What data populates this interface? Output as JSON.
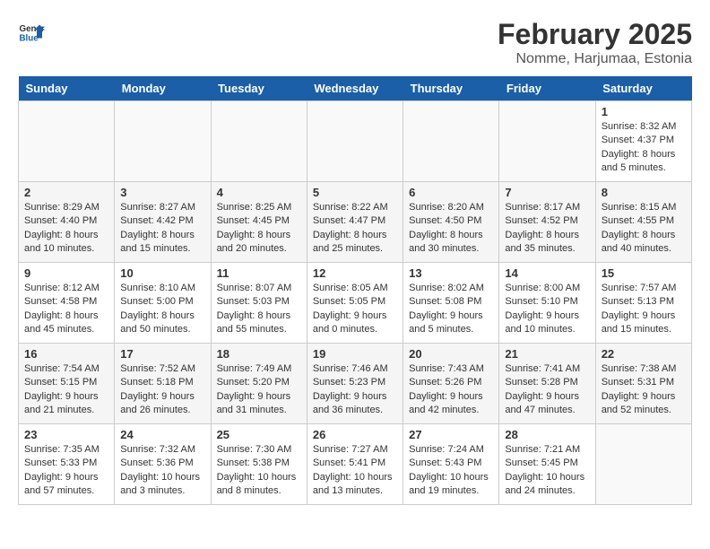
{
  "header": {
    "logo_line1": "General",
    "logo_line2": "Blue",
    "title": "February 2025",
    "subtitle": "Nomme, Harjumaa, Estonia"
  },
  "days_of_week": [
    "Sunday",
    "Monday",
    "Tuesday",
    "Wednesday",
    "Thursday",
    "Friday",
    "Saturday"
  ],
  "weeks": [
    [
      {
        "num": "",
        "info": ""
      },
      {
        "num": "",
        "info": ""
      },
      {
        "num": "",
        "info": ""
      },
      {
        "num": "",
        "info": ""
      },
      {
        "num": "",
        "info": ""
      },
      {
        "num": "",
        "info": ""
      },
      {
        "num": "1",
        "info": "Sunrise: 8:32 AM\nSunset: 4:37 PM\nDaylight: 8 hours and 5 minutes."
      }
    ],
    [
      {
        "num": "2",
        "info": "Sunrise: 8:29 AM\nSunset: 4:40 PM\nDaylight: 8 hours and 10 minutes."
      },
      {
        "num": "3",
        "info": "Sunrise: 8:27 AM\nSunset: 4:42 PM\nDaylight: 8 hours and 15 minutes."
      },
      {
        "num": "4",
        "info": "Sunrise: 8:25 AM\nSunset: 4:45 PM\nDaylight: 8 hours and 20 minutes."
      },
      {
        "num": "5",
        "info": "Sunrise: 8:22 AM\nSunset: 4:47 PM\nDaylight: 8 hours and 25 minutes."
      },
      {
        "num": "6",
        "info": "Sunrise: 8:20 AM\nSunset: 4:50 PM\nDaylight: 8 hours and 30 minutes."
      },
      {
        "num": "7",
        "info": "Sunrise: 8:17 AM\nSunset: 4:52 PM\nDaylight: 8 hours and 35 minutes."
      },
      {
        "num": "8",
        "info": "Sunrise: 8:15 AM\nSunset: 4:55 PM\nDaylight: 8 hours and 40 minutes."
      }
    ],
    [
      {
        "num": "9",
        "info": "Sunrise: 8:12 AM\nSunset: 4:58 PM\nDaylight: 8 hours and 45 minutes."
      },
      {
        "num": "10",
        "info": "Sunrise: 8:10 AM\nSunset: 5:00 PM\nDaylight: 8 hours and 50 minutes."
      },
      {
        "num": "11",
        "info": "Sunrise: 8:07 AM\nSunset: 5:03 PM\nDaylight: 8 hours and 55 minutes."
      },
      {
        "num": "12",
        "info": "Sunrise: 8:05 AM\nSunset: 5:05 PM\nDaylight: 9 hours and 0 minutes."
      },
      {
        "num": "13",
        "info": "Sunrise: 8:02 AM\nSunset: 5:08 PM\nDaylight: 9 hours and 5 minutes."
      },
      {
        "num": "14",
        "info": "Sunrise: 8:00 AM\nSunset: 5:10 PM\nDaylight: 9 hours and 10 minutes."
      },
      {
        "num": "15",
        "info": "Sunrise: 7:57 AM\nSunset: 5:13 PM\nDaylight: 9 hours and 15 minutes."
      }
    ],
    [
      {
        "num": "16",
        "info": "Sunrise: 7:54 AM\nSunset: 5:15 PM\nDaylight: 9 hours and 21 minutes."
      },
      {
        "num": "17",
        "info": "Sunrise: 7:52 AM\nSunset: 5:18 PM\nDaylight: 9 hours and 26 minutes."
      },
      {
        "num": "18",
        "info": "Sunrise: 7:49 AM\nSunset: 5:20 PM\nDaylight: 9 hours and 31 minutes."
      },
      {
        "num": "19",
        "info": "Sunrise: 7:46 AM\nSunset: 5:23 PM\nDaylight: 9 hours and 36 minutes."
      },
      {
        "num": "20",
        "info": "Sunrise: 7:43 AM\nSunset: 5:26 PM\nDaylight: 9 hours and 42 minutes."
      },
      {
        "num": "21",
        "info": "Sunrise: 7:41 AM\nSunset: 5:28 PM\nDaylight: 9 hours and 47 minutes."
      },
      {
        "num": "22",
        "info": "Sunrise: 7:38 AM\nSunset: 5:31 PM\nDaylight: 9 hours and 52 minutes."
      }
    ],
    [
      {
        "num": "23",
        "info": "Sunrise: 7:35 AM\nSunset: 5:33 PM\nDaylight: 9 hours and 57 minutes."
      },
      {
        "num": "24",
        "info": "Sunrise: 7:32 AM\nSunset: 5:36 PM\nDaylight: 10 hours and 3 minutes."
      },
      {
        "num": "25",
        "info": "Sunrise: 7:30 AM\nSunset: 5:38 PM\nDaylight: 10 hours and 8 minutes."
      },
      {
        "num": "26",
        "info": "Sunrise: 7:27 AM\nSunset: 5:41 PM\nDaylight: 10 hours and 13 minutes."
      },
      {
        "num": "27",
        "info": "Sunrise: 7:24 AM\nSunset: 5:43 PM\nDaylight: 10 hours and 19 minutes."
      },
      {
        "num": "28",
        "info": "Sunrise: 7:21 AM\nSunset: 5:45 PM\nDaylight: 10 hours and 24 minutes."
      },
      {
        "num": "",
        "info": ""
      }
    ]
  ]
}
